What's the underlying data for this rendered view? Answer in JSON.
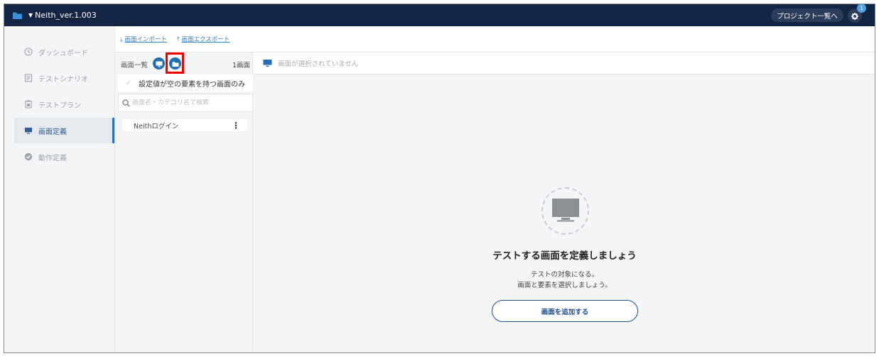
{
  "topbar": {
    "project_name": "Neith_ver.1.003",
    "project_list_button": "プロジェクト一覧へ",
    "notification_count": "1"
  },
  "sidebar": {
    "items": [
      {
        "label": "ダッシュボード",
        "icon": "clock-icon"
      },
      {
        "label": "テストシナリオ",
        "icon": "document-icon"
      },
      {
        "label": "テストプラン",
        "icon": "clipboard-icon"
      },
      {
        "label": "画面定義",
        "icon": "monitor-icon",
        "active": true
      },
      {
        "label": "動作定義",
        "icon": "check-circle-icon"
      }
    ]
  },
  "toolbar": {
    "import_label": "画面インポート",
    "export_label": "画面エクスポート"
  },
  "screen_list": {
    "title": "画面一覧",
    "count": "1画面",
    "filter_label": "設定値が空の要素を持つ画面のみ",
    "search_placeholder": "画面名・カテゴリ名で検索",
    "items": [
      {
        "name": "Neithログイン"
      }
    ]
  },
  "main": {
    "header_text": "画面が選択されていません",
    "empty_title": "テストする画面を定義しましょう",
    "empty_line1": "テストの対象になる。",
    "empty_line2": "画面と要素を選択しましょう。",
    "add_button": "画面を追加する"
  },
  "colors": {
    "topbar_bg": "#132543",
    "accent": "#1f6fb5",
    "highlight_box": "#e00000"
  }
}
